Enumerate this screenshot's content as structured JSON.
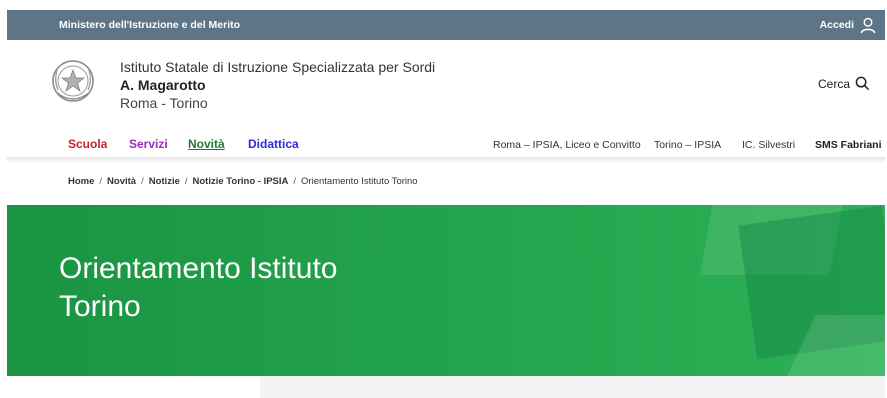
{
  "topbar": {
    "ministry": "Ministero dell'Istruzione e del Merito",
    "login_label": "Accedi",
    "bg_color": "#5d7586"
  },
  "header": {
    "line1": "Istituto Statale di Istruzione Specializzata per Sordi",
    "line2": "A. Magarotto",
    "line3": "Roma - Torino",
    "search_label": "Cerca"
  },
  "nav": {
    "main": [
      {
        "label": "Scuola",
        "color": "#c8202f"
      },
      {
        "label": "Servizi",
        "color": "#9b2ac4"
      },
      {
        "label": "Novità",
        "color": "#1f7a38"
      },
      {
        "label": "Didattica",
        "color": "#2d2bd6"
      }
    ],
    "secondary": [
      {
        "label": "Roma – IPSIA, Liceo e Convitto"
      },
      {
        "label": "Torino – IPSIA"
      },
      {
        "label": "IC. Silvestri"
      },
      {
        "label": "SMS Fabriani"
      }
    ]
  },
  "breadcrumb": {
    "items": [
      "Home",
      "Novità",
      "Notizie",
      "Notizie Torino - IPSIA"
    ],
    "current": "Orientamento Istituto Torino",
    "separator": "/"
  },
  "hero": {
    "title_line1": "Orientamento Istituto",
    "title_line2": "Torino",
    "color": "#1f9b46"
  }
}
